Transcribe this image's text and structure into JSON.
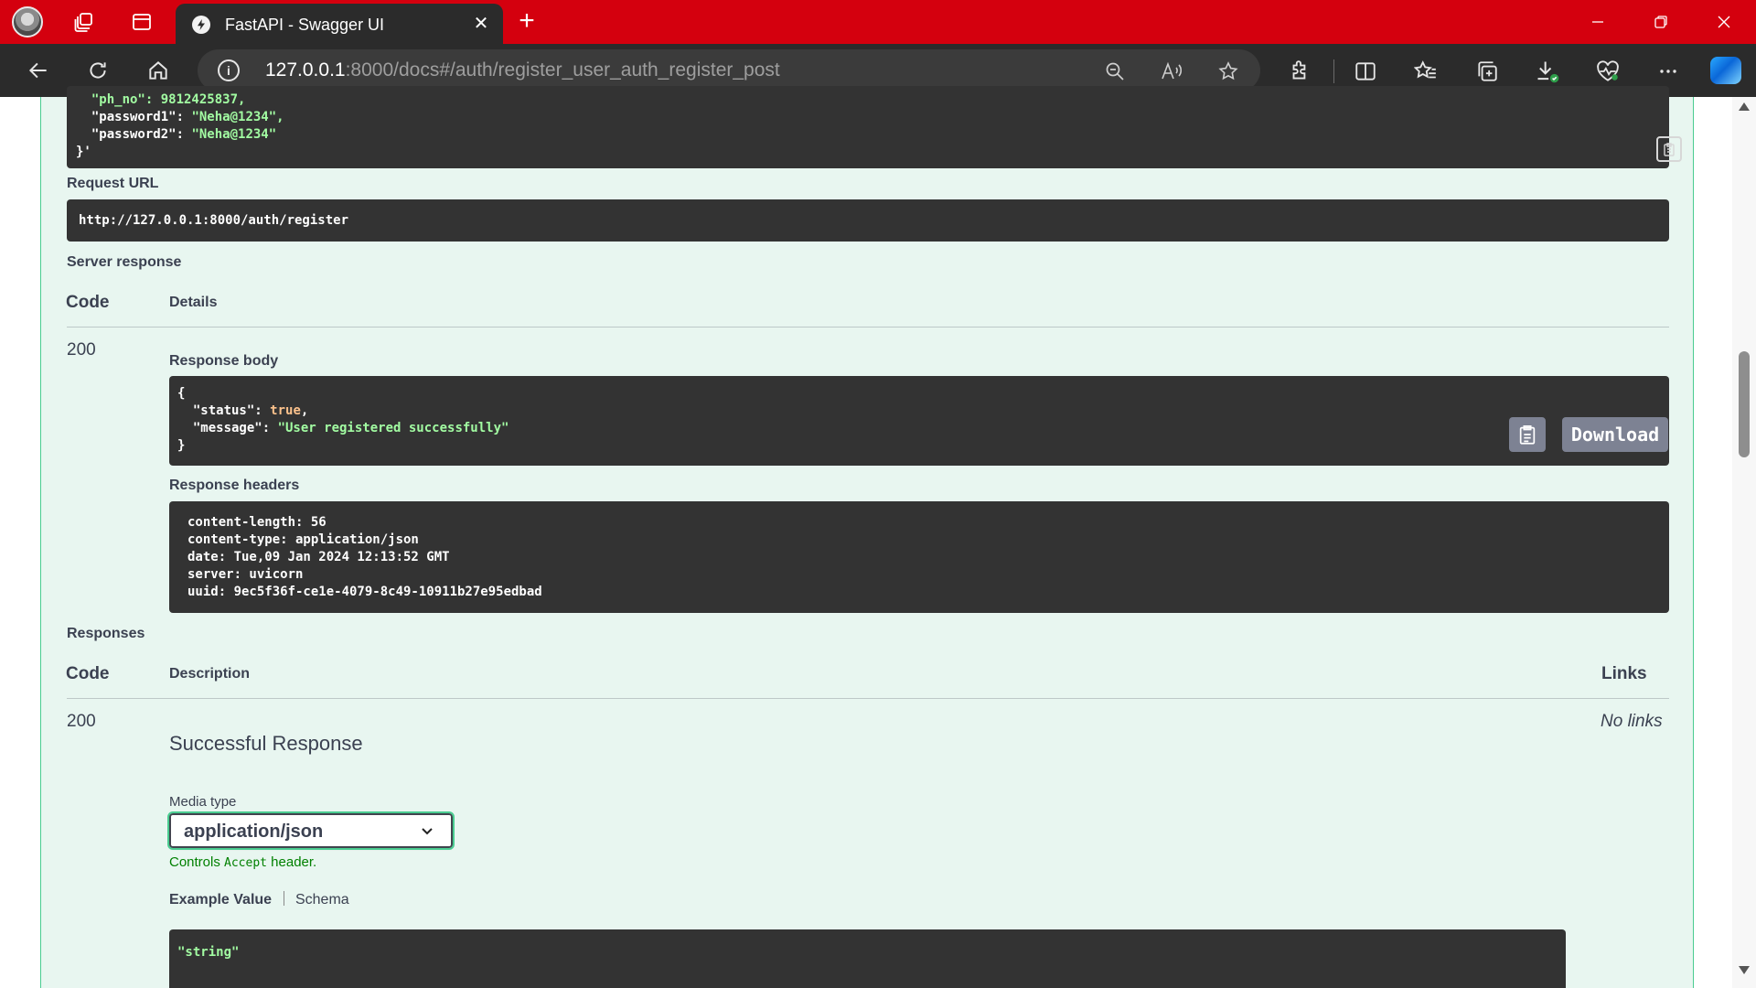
{
  "browser": {
    "tab_title": "FastAPI - Swagger UI",
    "url_host": "127.0.0.1",
    "url_rest": ":8000/docs#/auth/register_user_auth_register_post"
  },
  "request_body_tail": {
    "line_ph": "  \"ph_no\": 9812425837,",
    "line_pw1_key": "  \"password1\": ",
    "line_pw1_val": "\"Neha@1234\",",
    "line_pw2_key": "  \"password2\": ",
    "line_pw2_val": "\"Neha@1234\"",
    "line_end": "}'"
  },
  "request_url": {
    "label": "Request URL",
    "value": "http://127.0.0.1:8000/auth/register"
  },
  "server_response": {
    "label": "Server response",
    "col_code": "Code",
    "col_details": "Details",
    "code": "200",
    "body_label": "Response body",
    "body": {
      "open": "{",
      "status_key": "  \"status\": ",
      "status_val": "true",
      "comma1": ",",
      "message_key": "  \"message\": ",
      "message_val": "\"User registered successfully\"",
      "close": "}"
    },
    "download_label": "Download",
    "headers_label": "Response headers",
    "headers": [
      " content-length: 56 ",
      " content-type: application/json ",
      " date: Tue,09 Jan 2024 12:13:52 GMT ",
      " server: uvicorn ",
      " uuid: 9ec5f36f-ce1e-4079-8c49-10911b27e95edbad "
    ]
  },
  "responses": {
    "label": "Responses",
    "col_code": "Code",
    "col_description": "Description",
    "col_links": "Links",
    "code": "200",
    "description": "Successful Response",
    "links": "No links",
    "media_type_label": "Media type",
    "media_type_value": "application/json",
    "controls_pre": "Controls ",
    "controls_code": "Accept",
    "controls_post": " header.",
    "tab_example": "Example Value",
    "tab_schema": "Schema",
    "example": "\"string\""
  }
}
